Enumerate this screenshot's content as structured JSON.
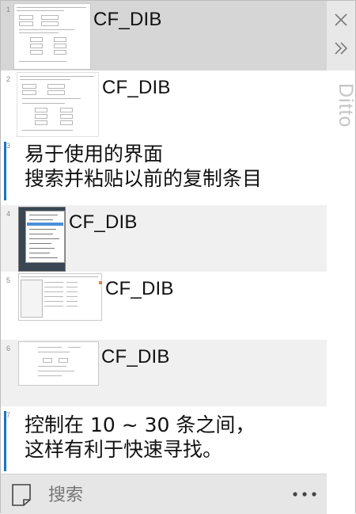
{
  "window": {
    "title": "Ditto"
  },
  "clips": [
    {
      "index": "1",
      "format": "CF_DIB"
    },
    {
      "index": "2",
      "format": "CF_DIB"
    },
    {
      "index": "3",
      "lines": [
        "易于使用的界面",
        "搜索并粘贴以前的复制条目"
      ]
    },
    {
      "index": "4",
      "format": "CF_DIB"
    },
    {
      "index": "5",
      "format": "CF_DIB"
    },
    {
      "index": "6",
      "format": "CF_DIB"
    },
    {
      "index": "7",
      "lines": [
        "控制在 10 ~ 30 条之间，",
        "这样有利于快速寻找。"
      ]
    }
  ],
  "search": {
    "placeholder": "搜索"
  },
  "icons": {
    "close": "close-icon",
    "expand": "double-chevron-right-icon",
    "document": "document-icon",
    "more": "more-icon"
  },
  "colors": {
    "accent": "#1a73c9",
    "selected_row": "#d6d6d6",
    "alt_row": "#f0f0f0"
  }
}
